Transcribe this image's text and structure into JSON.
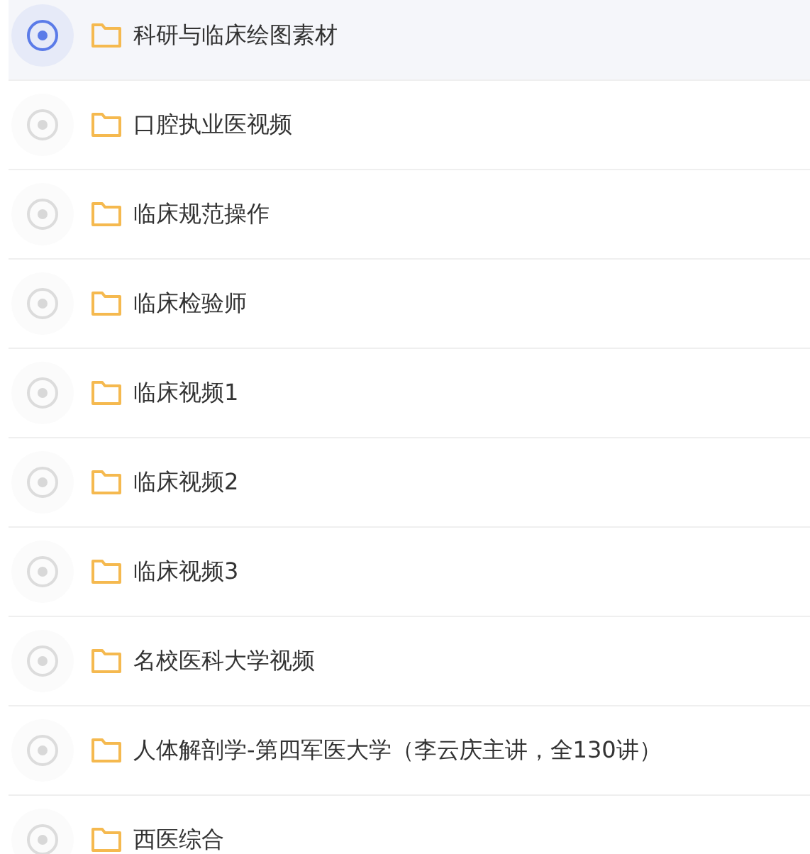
{
  "folders": [
    {
      "name": "科研与临床绘图素材",
      "selected": true
    },
    {
      "name": "口腔执业医视频",
      "selected": false
    },
    {
      "name": "临床规范操作",
      "selected": false
    },
    {
      "name": "临床检验师",
      "selected": false
    },
    {
      "name": "临床视频1",
      "selected": false
    },
    {
      "name": "临床视频2",
      "selected": false
    },
    {
      "name": "临床视频3",
      "selected": false
    },
    {
      "name": "名校医科大学视频",
      "selected": false
    },
    {
      "name": "人体解剖学-第四军医大学（李云庆主讲，全130讲）",
      "selected": false
    },
    {
      "name": "西医综合",
      "selected": false
    }
  ]
}
